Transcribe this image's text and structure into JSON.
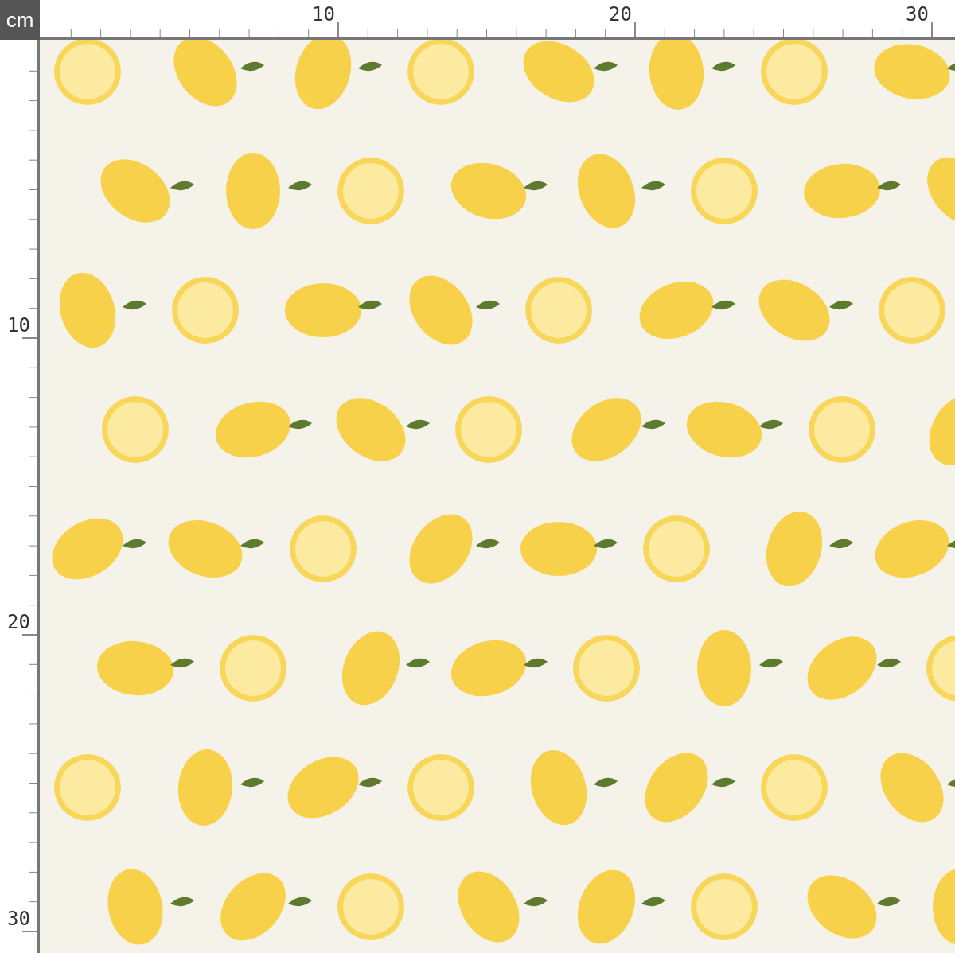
{
  "unit": "cm",
  "top_ruler": {
    "labels": [
      "10",
      "20",
      "30"
    ]
  },
  "left_ruler": {
    "labels": [
      "10",
      "20",
      "30"
    ]
  }
}
